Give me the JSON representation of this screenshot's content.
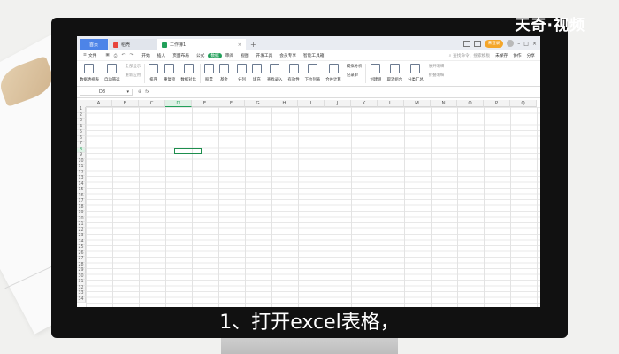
{
  "watermark": "天奇·视频",
  "subtitle": "1、打开excel表格，",
  "titlebar": {
    "tabs": [
      {
        "label": "首页",
        "kind": "home"
      },
      {
        "label": "稻壳",
        "kind": "doc",
        "color": "#e8453c"
      },
      {
        "label": "工作簿1",
        "kind": "sheet",
        "color": "#22a05a"
      }
    ],
    "new_tab": "+",
    "login": "未登录"
  },
  "menubar": {
    "file": "文件",
    "items": [
      "开始",
      "插入",
      "页面布局",
      "公式",
      "数据",
      "审阅",
      "视图",
      "开发工具",
      "会员专享",
      "智能工具箱"
    ],
    "active": "数据",
    "search_placeholder": "查找命令、搜索模板",
    "unsaved": "未保存",
    "collab": "协作",
    "share": "分享"
  },
  "ribbon": {
    "pivot": "数据透视表",
    "auto_filter": "自动筛选",
    "show_all": "全部显示",
    "reapply": "重新应用",
    "sort": "排序",
    "dup": "重复项",
    "compare": "数据对比",
    "stock": "股票",
    "fund": "基金",
    "split": "分列",
    "fill": "填充",
    "find_entry": "查找录入",
    "validity": "有效性",
    "dropdown": "下拉列表",
    "consolidate": "合并计算",
    "simulate": "模拟分析",
    "record": "记录单",
    "group": "创建组",
    "ungroup": "取消组合",
    "subtotal": "分类汇总",
    "expand": "展开明细",
    "collapse": "折叠明细"
  },
  "formulabar": {
    "cell_ref": "D8",
    "fx": "fx"
  },
  "grid": {
    "columns": [
      "A",
      "B",
      "C",
      "D",
      "E",
      "F",
      "G",
      "H",
      "I",
      "J",
      "K",
      "L",
      "M",
      "N",
      "O",
      "P",
      "Q"
    ],
    "active_column": "D",
    "rows": [
      "1",
      "2",
      "3",
      "4",
      "5",
      "6",
      "7",
      "8",
      "9",
      "10",
      "11",
      "12",
      "13",
      "14",
      "15",
      "16",
      "17",
      "18",
      "19",
      "20",
      "21",
      "22",
      "23",
      "24",
      "25",
      "26",
      "27",
      "28",
      "29",
      "30",
      "31",
      "32",
      "33",
      "34"
    ],
    "active_row": "8"
  },
  "colors": {
    "accent": "#22a05a",
    "home_tab": "#4d84e8",
    "login": "#f4a62a"
  }
}
